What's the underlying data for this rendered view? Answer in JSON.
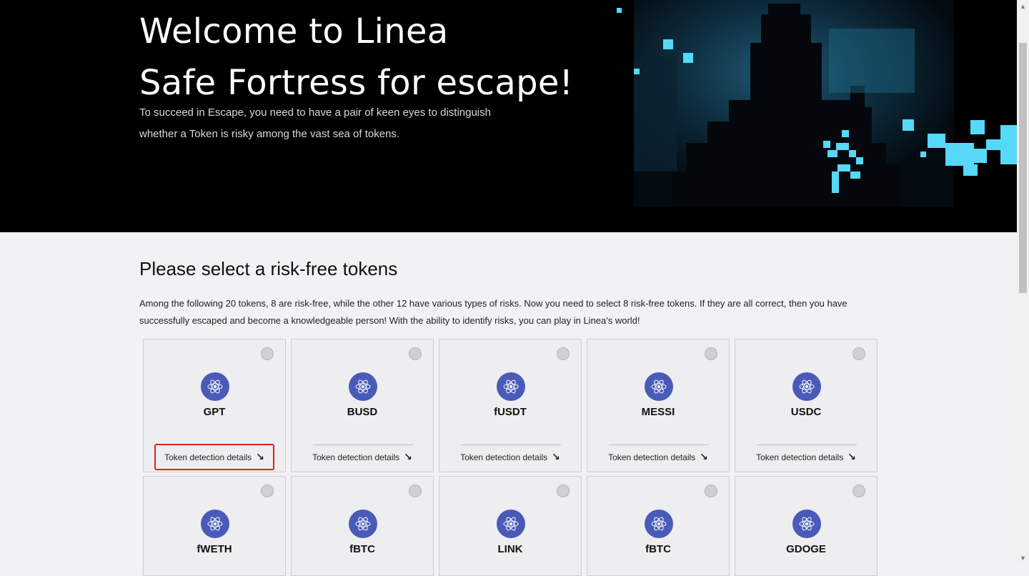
{
  "hero": {
    "title_line1": "Welcome to Linea",
    "title_line2": "Safe Fortress for escape!",
    "description_line1": "To succeed in Escape, you need to have a pair of keen eyes to distinguish",
    "description_line2": "whether a Token is risky among the vast sea of tokens."
  },
  "section": {
    "title": "Please select a risk-free tokens",
    "description_line1": "Among the following 20 tokens, 8 are risk-free, while the other 12 have various types of risks. Now you need to select 8 risk-free tokens. If they are all correct, then you have",
    "description_line2": "successfully escaped and become a knowledgeable person! With the ability to identify risks, you can play in Linea's world!"
  },
  "tokens": [
    {
      "name": "GPT"
    },
    {
      "name": "BUSD"
    },
    {
      "name": "fUSDT"
    },
    {
      "name": "MESSI"
    },
    {
      "name": "USDC"
    },
    {
      "name": "fWETH"
    },
    {
      "name": "fBTC"
    },
    {
      "name": "LINK"
    },
    {
      "name": "fBTC"
    },
    {
      "name": "GDOGE"
    }
  ],
  "details_label": "Token detection details",
  "details_arrow": "↘",
  "colors": {
    "hero_bg": "#000000",
    "token_icon": "#4a5ab8",
    "pixel_accent": "#56d8f8",
    "highlight": "#e02020"
  },
  "icons": {
    "token": "atom-icon",
    "arrow": "arrow-down-right-icon"
  }
}
